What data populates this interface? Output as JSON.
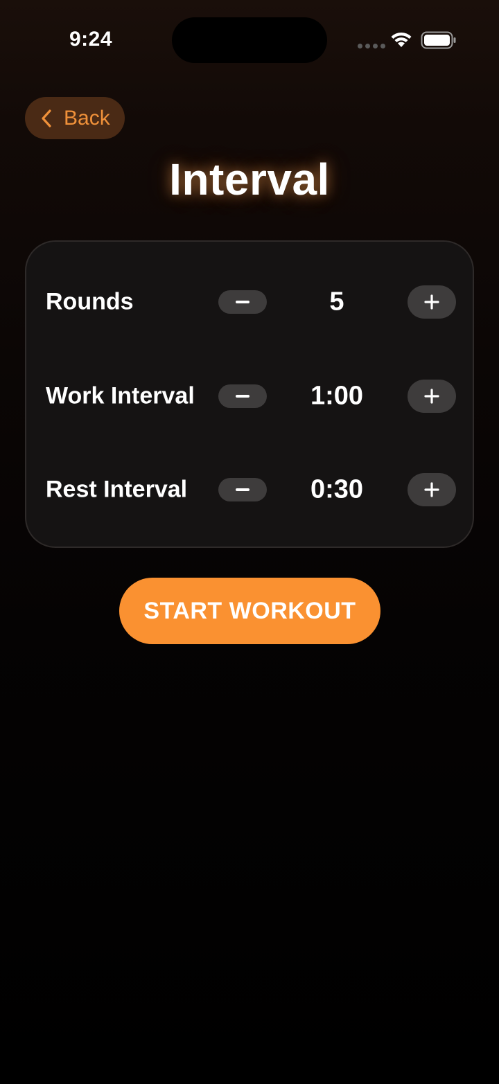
{
  "status_bar": {
    "time": "9:24",
    "icons": [
      "cellular-signal-icon",
      "wifi-icon",
      "battery-icon"
    ]
  },
  "nav": {
    "back_label": "Back",
    "back_icon": "chevron-left-icon"
  },
  "page": {
    "title": "Interval"
  },
  "settings": {
    "rows": [
      {
        "label": "Rounds",
        "value": "5"
      },
      {
        "label": "Work Interval",
        "value": "1:00"
      },
      {
        "label": "Rest Interval",
        "value": "0:30"
      }
    ],
    "decrement_icon": "minus-icon",
    "increment_icon": "plus-icon"
  },
  "actions": {
    "start_label": "START WORKOUT"
  },
  "colors": {
    "accent": "#fa9131",
    "back_button_bg": "#4a2a15",
    "back_text": "#f0913a",
    "card_bg": "#151313",
    "stepper_bg": "#3e3c3c"
  }
}
